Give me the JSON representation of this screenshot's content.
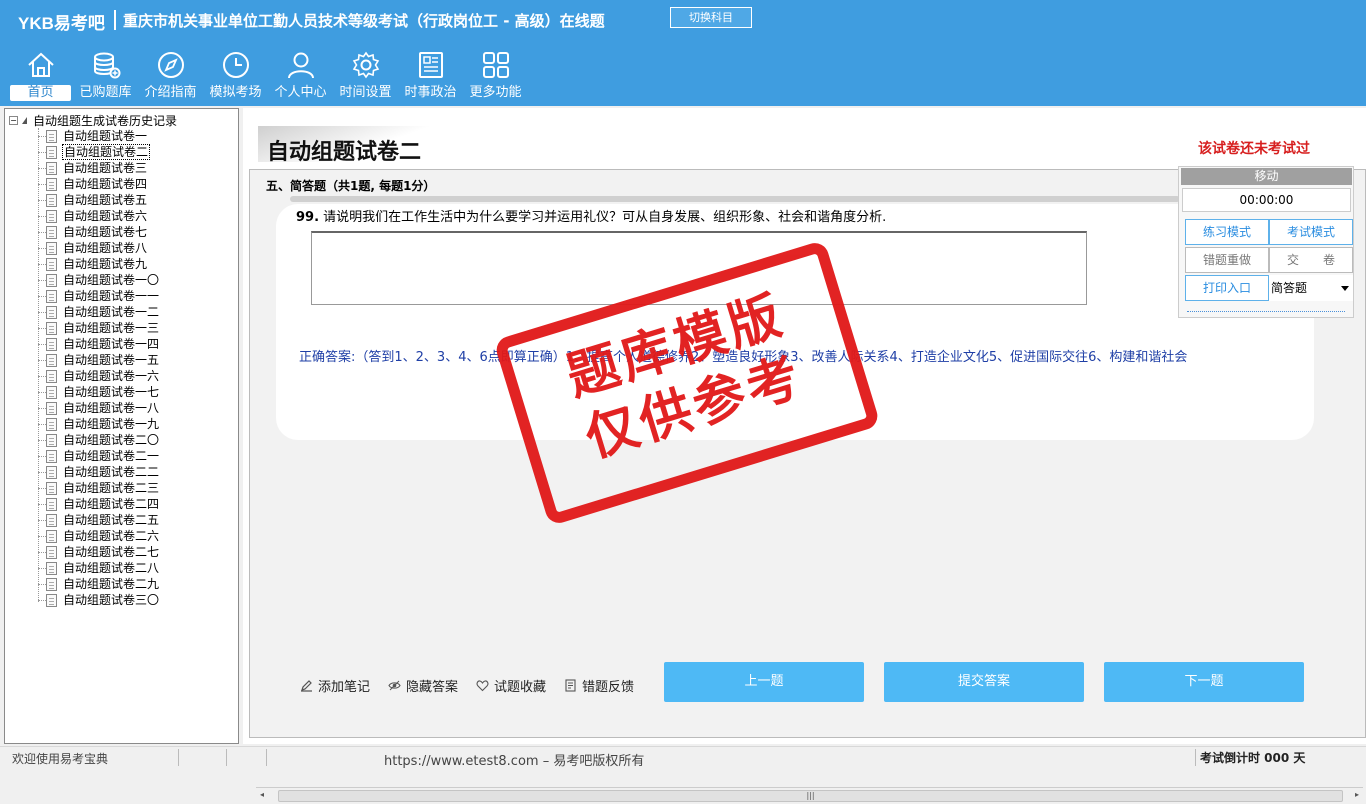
{
  "header": {
    "logo": "YKB易考吧",
    "title": "重庆市机关事业单位工勤人员技术等级考试（行政岗位工 - 高级）在线题",
    "switch_label": "切换科目"
  },
  "nav": [
    {
      "label": "首页",
      "icon": "home-icon"
    },
    {
      "label": "已购题库",
      "icon": "database-icon"
    },
    {
      "label": "介绍指南",
      "icon": "compass-icon"
    },
    {
      "label": "模拟考场",
      "icon": "clock-icon"
    },
    {
      "label": "个人中心",
      "icon": "user-icon"
    },
    {
      "label": "时间设置",
      "icon": "gear-icon"
    },
    {
      "label": "时事政治",
      "icon": "newspaper-icon"
    },
    {
      "label": "更多功能",
      "icon": "grid-icon"
    }
  ],
  "tree": {
    "root": "自动组题生成试卷历史记录",
    "items": [
      "自动组题试卷一",
      "自动组题试卷二",
      "自动组题试卷三",
      "自动组题试卷四",
      "自动组题试卷五",
      "自动组题试卷六",
      "自动组题试卷七",
      "自动组题试卷八",
      "自动组题试卷九",
      "自动组题试卷一〇",
      "自动组题试卷一一",
      "自动组题试卷一二",
      "自动组题试卷一三",
      "自动组题试卷一四",
      "自动组题试卷一五",
      "自动组题试卷一六",
      "自动组题试卷一七",
      "自动组题试卷一八",
      "自动组题试卷一九",
      "自动组题试卷二〇",
      "自动组题试卷二一",
      "自动组题试卷二二",
      "自动组题试卷二三",
      "自动组题试卷二四",
      "自动组题试卷二五",
      "自动组题试卷二六",
      "自动组题试卷二七",
      "自动组题试卷二八",
      "自动组题试卷二九",
      "自动组题试卷三〇"
    ],
    "selected_index": 1
  },
  "main": {
    "paper_title": "自动组题试卷二",
    "not_taken": "该试卷还未考试过",
    "section_title": "五、简答题（共1题, 每题1分）",
    "question_number": "99.",
    "question_text": "请说明我们在工作生活中为什么要学习并运用礼仪？可从自身发展、组织形象、社会和谐角度分析.",
    "correct_answer": "正确答案:（答到1、2、3、4、6点即算正确）1、提高个人道德修养2、塑造良好形象3、改善人际关系4、打造企业文化5、促进国际交往6、构建和谐社会",
    "tools": [
      {
        "label": "添加笔记",
        "icon": "pencil-icon"
      },
      {
        "label": "隐藏答案",
        "icon": "eye-icon"
      },
      {
        "label": "试题收藏",
        "icon": "heart-icon"
      },
      {
        "label": "错题反馈",
        "icon": "feedback-icon"
      }
    ],
    "prev_label": "上一题",
    "submit_label": "提交答案",
    "next_label": "下一题"
  },
  "stamp": {
    "line1": "题库模版",
    "line2": "仅供参考"
  },
  "panel": {
    "head": "移动",
    "timer": "00:00:00",
    "practice_mode": "练习模式",
    "exam_mode": "考试模式",
    "redo_wrong": "错题重做",
    "hand_in": "交　　卷",
    "print": "打印入口",
    "type_select": "简答题"
  },
  "status": {
    "welcome": "欢迎使用易考宝典",
    "copyright": "https://www.etest8.com – 易考吧版权所有",
    "countdown": "考试倒计时 000 天"
  },
  "colors": {
    "header": "#3f9de0",
    "button": "#4eb9f5",
    "stamp": "#e11818",
    "answer": "#1f3fa6"
  }
}
